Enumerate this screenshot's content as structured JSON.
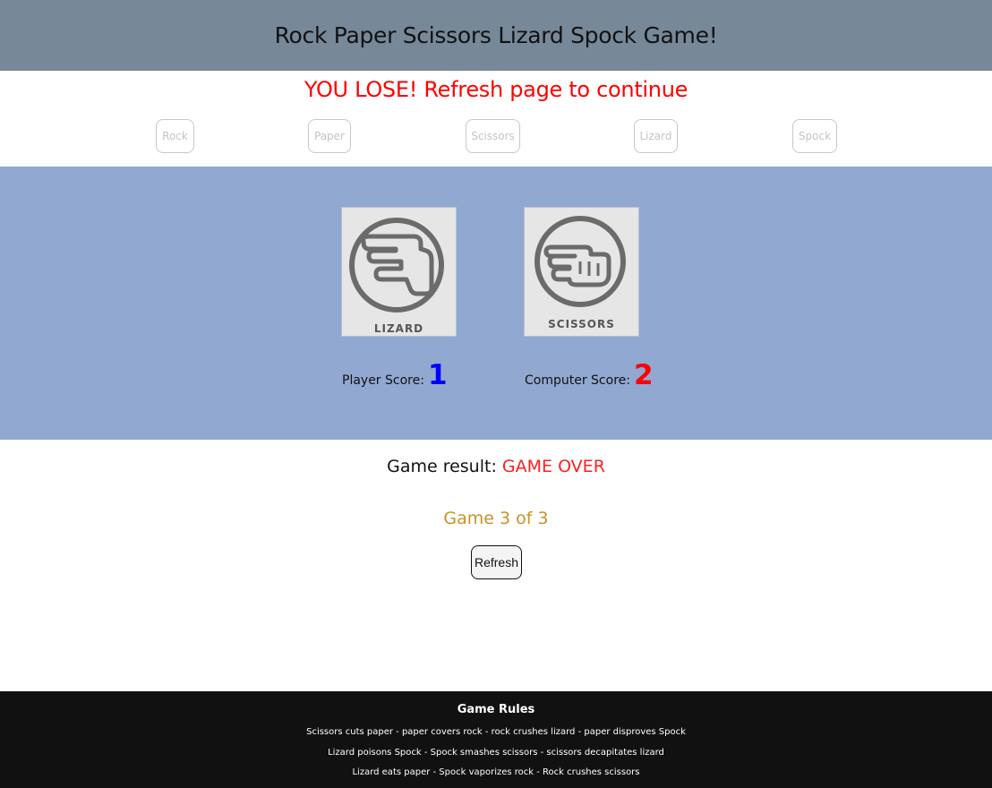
{
  "header": {
    "title": "Rock Paper Scissors Lizard Spock Game!"
  },
  "status_message": "YOU LOSE! Refresh page to continue",
  "choices": [
    {
      "label": "Rock"
    },
    {
      "label": "Paper"
    },
    {
      "label": "Scissors"
    },
    {
      "label": "Lizard"
    },
    {
      "label": "Spock"
    }
  ],
  "player": {
    "card_label": "LIZARD",
    "card_icon": "lizard-hand-icon",
    "score_label": "Player Score:",
    "score": "1",
    "score_color": "#0000ff"
  },
  "computer": {
    "card_label": "SCISSORS",
    "card_icon": "scissors-hand-icon",
    "score_label": "Computer Score:",
    "score": "2",
    "score_color": "#ff0000"
  },
  "result": {
    "label": "Game result:",
    "value": "GAME OVER"
  },
  "game_count": "Game 3 of 3",
  "refresh_label": "Refresh",
  "footer": {
    "title": "Game Rules",
    "rules": [
      "Scissors cuts paper - paper covers rock - rock crushes lizard - paper disproves Spock",
      "Lizard poisons Spock - Spock smashes scissors - scissors decapitates lizard",
      "Lizard eats paper - Spock vaporizes rock - Rock crushes scissors"
    ]
  },
  "colors": {
    "header_bg": "#778899",
    "arena_bg": "#91a8d1",
    "lose_message": "#ff0000",
    "game_count": "#c8932a",
    "footer_bg": "#111111"
  }
}
